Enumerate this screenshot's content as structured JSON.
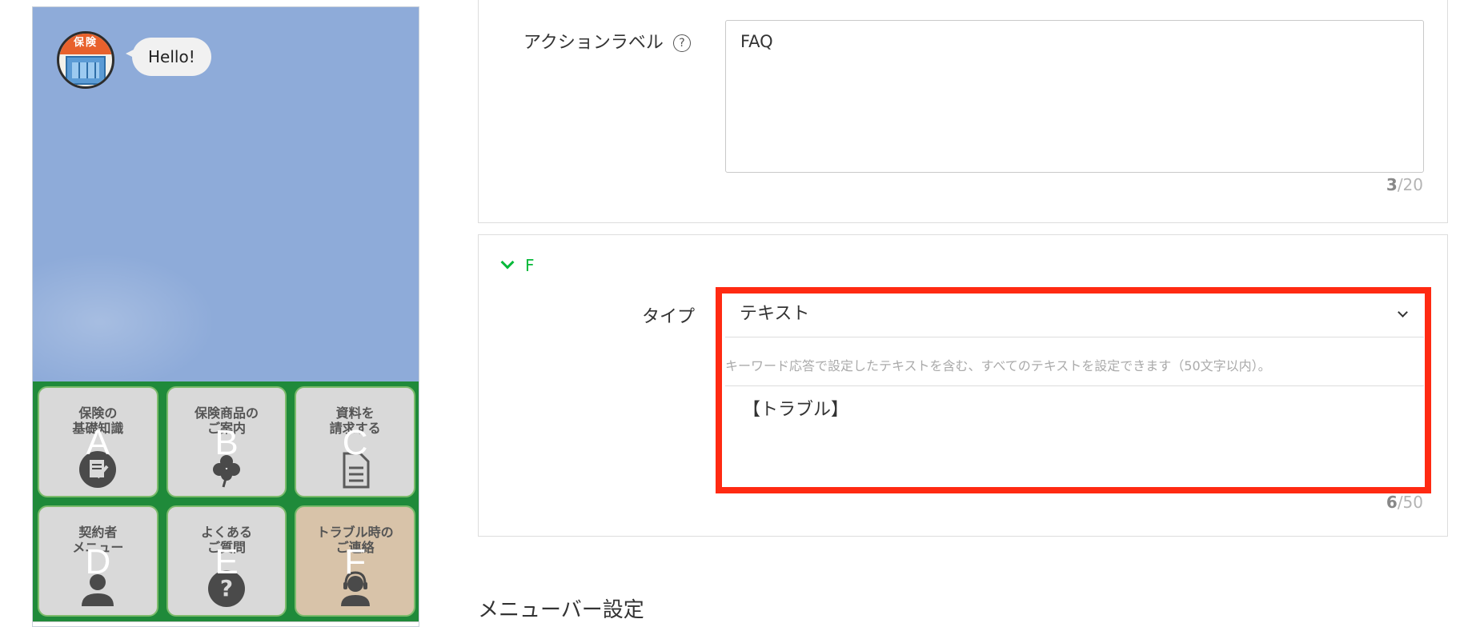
{
  "preview": {
    "avatar_sign": "保険",
    "greeting": "Hello!",
    "tiles": [
      {
        "label": "保険の\n基礎知識",
        "letter": "A",
        "icon": "notepad-icon"
      },
      {
        "label": "保険商品の\nご案内",
        "letter": "B",
        "icon": "clover-icon"
      },
      {
        "label": "資料を\n請求する",
        "letter": "C",
        "icon": "document-icon"
      },
      {
        "label": "契約者\nメニュー",
        "letter": "D",
        "icon": "person-icon"
      },
      {
        "label": "よくある\nご質問",
        "letter": "E",
        "icon": "question-icon"
      },
      {
        "label": "トラブル時の\nご連絡",
        "letter": "F",
        "icon": "headset-operator-icon"
      }
    ]
  },
  "action_label_field": {
    "label": "アクションラベル",
    "help": "?",
    "value": "FAQ",
    "count_current": "3",
    "count_max": "/20"
  },
  "section_f": {
    "title": "F",
    "type_label": "タイプ",
    "type_value": "テキスト",
    "hint": "キーワード応答で設定したテキストを含む、すべてのテキストを設定できます（50文字以内）。",
    "message": "【トラブル】",
    "count_current": "6",
    "count_max": "/50"
  },
  "menubar_heading": "メニューバー設定",
  "colors": {
    "accent": "#06b93a",
    "highlight": "#ff2a12",
    "menu_bg": "#1f8a3a"
  }
}
